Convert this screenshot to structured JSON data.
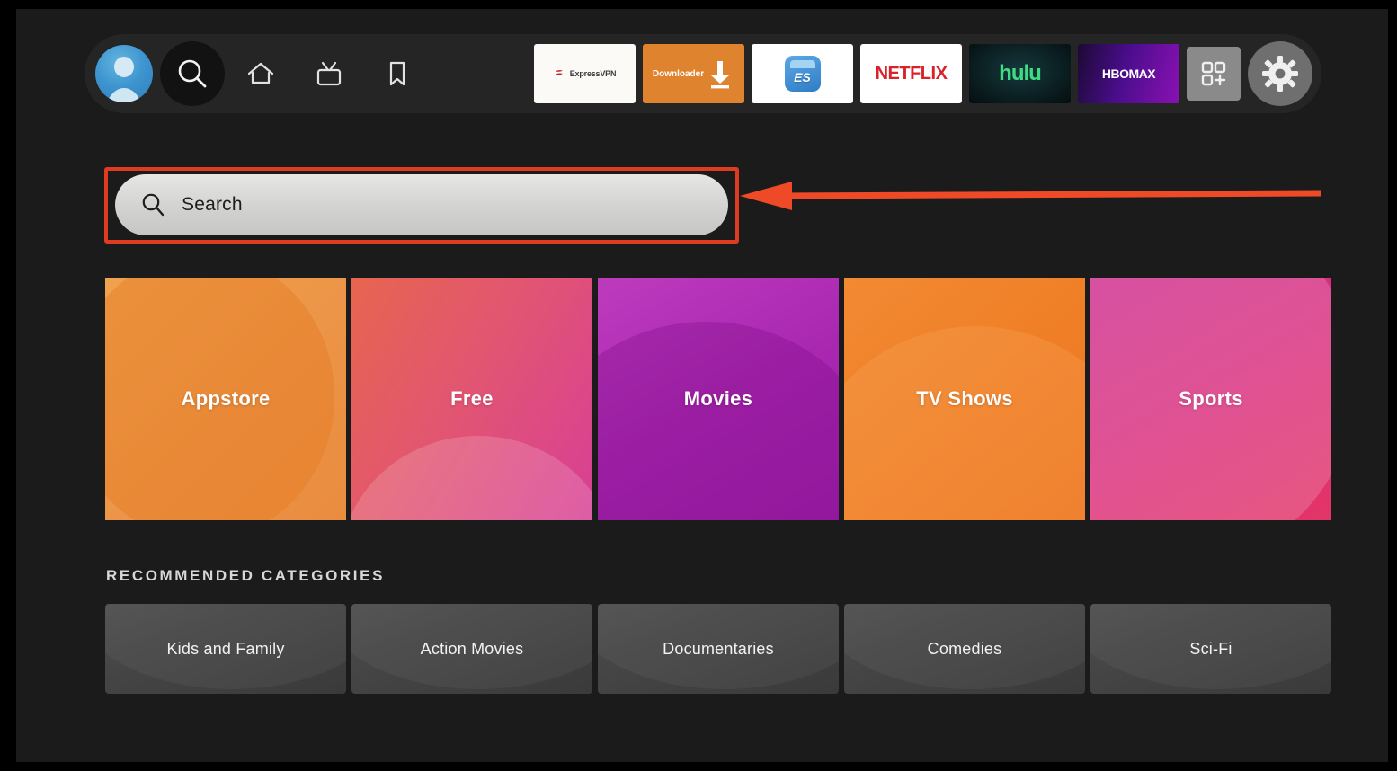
{
  "nav": {
    "left_items": [
      {
        "name": "profile-avatar",
        "label": "Profile",
        "icon": "avatar-icon"
      },
      {
        "name": "search",
        "label": "Search",
        "icon": "search-icon",
        "focused": true
      },
      {
        "name": "home",
        "label": "Home",
        "icon": "home-icon"
      },
      {
        "name": "live",
        "label": "Live TV",
        "icon": "live-tv-icon"
      },
      {
        "name": "library",
        "label": "Library",
        "icon": "bookmark-icon"
      }
    ],
    "apps": [
      {
        "name": "expressvpn",
        "label": "ExpressVPN",
        "bg": "#fbfaf7",
        "accent": "#d9333f"
      },
      {
        "name": "downloader",
        "label": "Downloader",
        "bg": "#e0832f",
        "accent": "#ffffff"
      },
      {
        "name": "es-file-explorer",
        "label": "ES",
        "bg": "#ffffff",
        "accent": "#2e7cc4"
      },
      {
        "name": "netflix",
        "label": "NETFLIX",
        "bg": "#ffffff",
        "accent": "#d8232a"
      },
      {
        "name": "hulu",
        "label": "hulu",
        "bg": "#0b1f22",
        "accent": "#3ddc84"
      },
      {
        "name": "hbomax",
        "label": "HBOMAX",
        "bg": "#4a0d8c",
        "accent": "#ffffff"
      }
    ],
    "apps_grid_label": "Apps",
    "settings_label": "Settings"
  },
  "search": {
    "placeholder": "Search",
    "value": "",
    "highlight_color": "#e03a20"
  },
  "annotation": {
    "arrow_color": "#ef4a28",
    "points_to": "search"
  },
  "main_tiles": [
    {
      "label": "Appstore",
      "color": "#ec9447"
    },
    {
      "label": "Free",
      "color": "#e25670"
    },
    {
      "label": "Movies",
      "color": "#a926b0"
    },
    {
      "label": "TV Shows",
      "color": "#ef7e26"
    },
    {
      "label": "Sports",
      "color": "#d92f7e"
    }
  ],
  "recommended": {
    "title": "RECOMMENDED CATEGORIES",
    "items": [
      {
        "label": "Kids and Family"
      },
      {
        "label": "Action Movies"
      },
      {
        "label": "Documentaries"
      },
      {
        "label": "Comedies"
      },
      {
        "label": "Sci-Fi"
      }
    ]
  }
}
